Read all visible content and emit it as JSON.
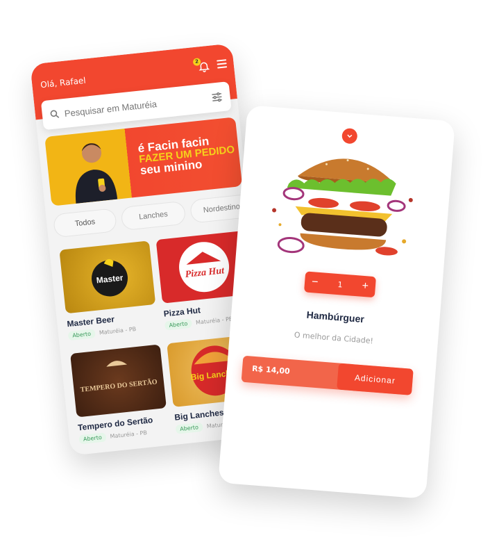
{
  "app": {
    "greeting": "Olá, Rafael",
    "notification_count": "2",
    "search": {
      "placeholder": "Pesquisar em Maturéia"
    },
    "banner": {
      "line1": "é Facin facin",
      "line2": "FAZER UM PEDIDO",
      "line3": "seu minino"
    },
    "categories": [
      {
        "label": "Todos"
      },
      {
        "label": "Lanches"
      },
      {
        "label": "Nordestino"
      }
    ],
    "restaurants": [
      {
        "name": "Master Beer",
        "status": "Aberto",
        "location": "Maturéia - PB",
        "logo_text": "Master"
      },
      {
        "name": "Pizza Hut",
        "status": "Aberto",
        "location": "Maturéia - PB",
        "logo_text": "Pizza Hut"
      },
      {
        "name": "Tempero do Sertão",
        "status": "Aberto",
        "location": "Maturéia - PB",
        "logo_text": "TEMPERO DO SERTÃO"
      },
      {
        "name": "Big Lanches",
        "status": "Aberto",
        "location": "Maturéia - PB",
        "logo_text": "Big Lanches"
      }
    ]
  },
  "product": {
    "name": "Hambúrguer",
    "description": "O melhor da Cidade!",
    "quantity": "1",
    "minus_label": "−",
    "plus_label": "+",
    "price": "R$ 14,00",
    "add_label": "Adicionar"
  },
  "colors": {
    "primary": "#f2472f",
    "banner_yellow": "#f2b515",
    "text_dark": "#202a44",
    "open_badge": "#3a9a5b"
  },
  "icons": [
    "bell-icon",
    "menu-icon",
    "search-icon",
    "filter-icon",
    "chevron-down-icon"
  ]
}
